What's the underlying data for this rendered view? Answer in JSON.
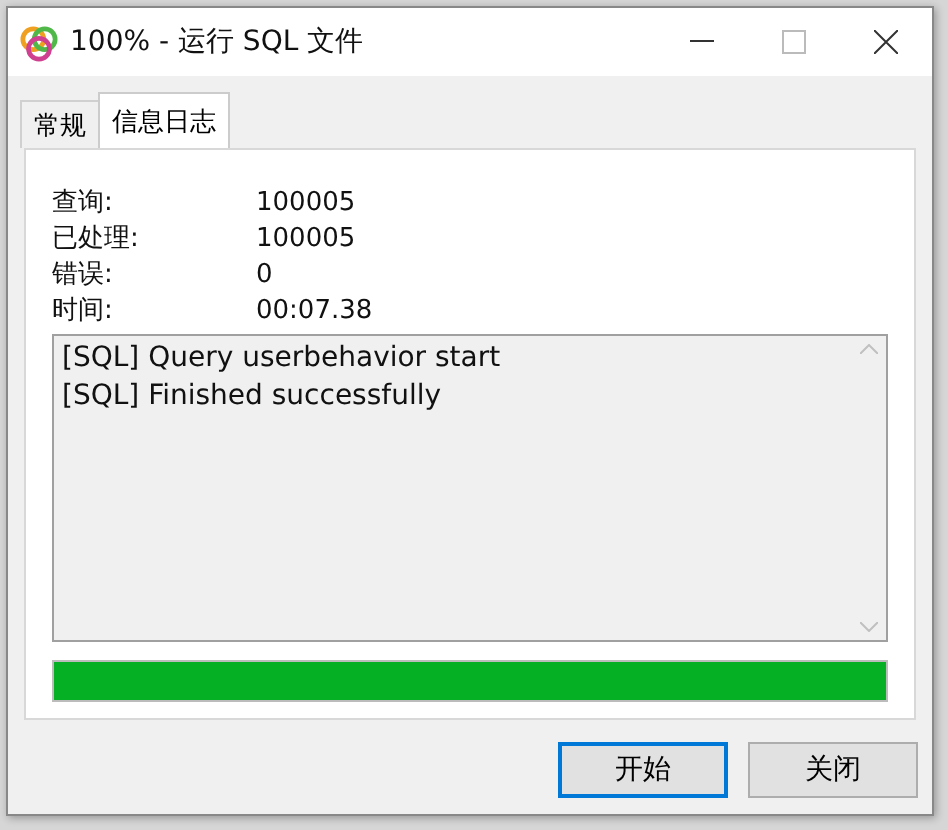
{
  "window": {
    "title": "100% - 运行 SQL 文件"
  },
  "tabs": [
    {
      "label": "常规",
      "selected": false
    },
    {
      "label": "信息日志",
      "selected": true
    }
  ],
  "stats": [
    {
      "label": "查询:",
      "value": "100005"
    },
    {
      "label": "已处理:",
      "value": "100005"
    },
    {
      "label": "错误:",
      "value": "0"
    },
    {
      "label": "时间:",
      "value": "00:07.38"
    }
  ],
  "log": [
    "[SQL] Query userbehavior start",
    "[SQL] Finished successfully"
  ],
  "progress": {
    "level": 1
  },
  "buttons": [
    {
      "label": "开始",
      "default": true
    },
    {
      "label": "关闭",
      "default": false
    }
  ]
}
